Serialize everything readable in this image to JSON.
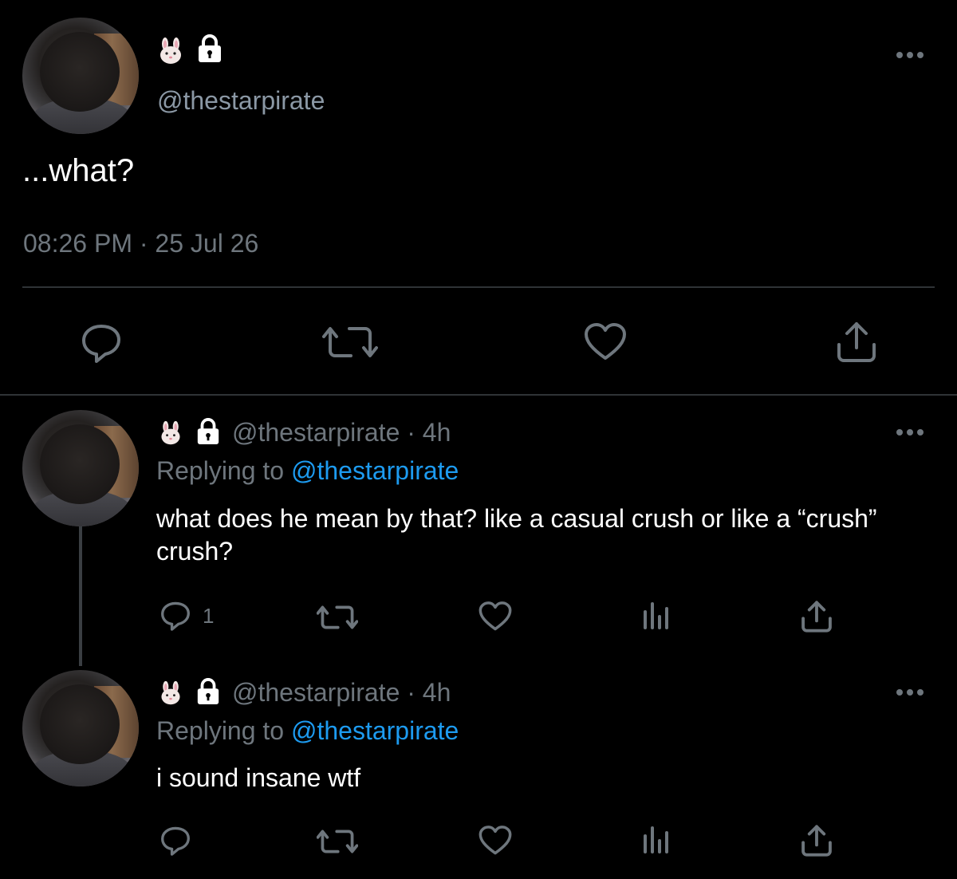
{
  "main_tweet": {
    "handle": "@thestarpirate",
    "text": "...what?",
    "timestamp": "08:26 PM · 25 Jul 26",
    "name_icons": [
      "rabbit-face-icon",
      "lock-icon"
    ],
    "actions": [
      "reply-icon",
      "retweet-icon",
      "like-icon",
      "share-icon"
    ]
  },
  "replies": [
    {
      "handle_line": "@thestarpirate · 4h",
      "replying_prefix": "Replying to ",
      "replying_to": "@thestarpirate",
      "text": "what does he mean by that? like a casual crush or like a “crush” crush?",
      "reply_count": "1",
      "name_icons": [
        "rabbit-face-icon",
        "lock-icon"
      ],
      "actions": [
        "reply-icon",
        "retweet-icon",
        "like-icon",
        "analytics-icon",
        "share-icon"
      ]
    },
    {
      "handle_line": "@thestarpirate · 4h",
      "replying_prefix": "Replying to ",
      "replying_to": "@thestarpirate",
      "text": "i sound insane wtf",
      "reply_count": "",
      "name_icons": [
        "rabbit-face-icon",
        "lock-icon"
      ],
      "actions": [
        "reply-icon",
        "retweet-icon",
        "like-icon",
        "analytics-icon",
        "share-icon"
      ]
    }
  ],
  "colors": {
    "background": "#000000",
    "text": "#ffffff",
    "secondary": "#6e767d",
    "accent": "#1d9bf0",
    "divider": "#2f3336"
  }
}
